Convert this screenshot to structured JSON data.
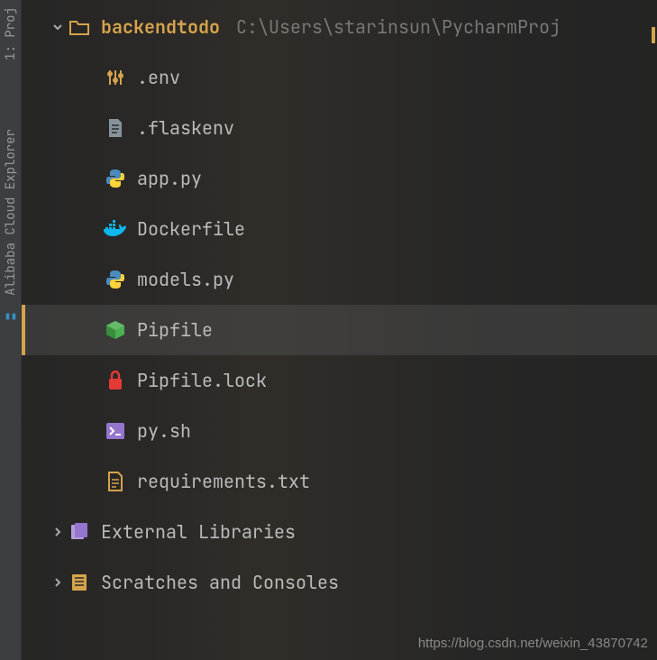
{
  "sidebar": {
    "tab1": "1: Proj",
    "tab2": "Alibaba Cloud Explorer"
  },
  "tree": {
    "folder": {
      "name": "backendtodo",
      "path": "C:\\Users\\starinsun\\PycharmProj"
    },
    "files": [
      {
        "name": ".env",
        "icon": "sliders"
      },
      {
        "name": ".flaskenv",
        "icon": "file-text"
      },
      {
        "name": "app.py",
        "icon": "python"
      },
      {
        "name": "Dockerfile",
        "icon": "docker"
      },
      {
        "name": "models.py",
        "icon": "python"
      },
      {
        "name": "Pipfile",
        "icon": "package",
        "selected": true
      },
      {
        "name": "Pipfile.lock",
        "icon": "lock"
      },
      {
        "name": "py.sh",
        "icon": "shell"
      },
      {
        "name": "requirements.txt",
        "icon": "doc"
      }
    ],
    "external": "External Libraries",
    "scratches": "Scratches and Consoles"
  },
  "watermark": "https://blog.csdn.net/weixin_43870742"
}
